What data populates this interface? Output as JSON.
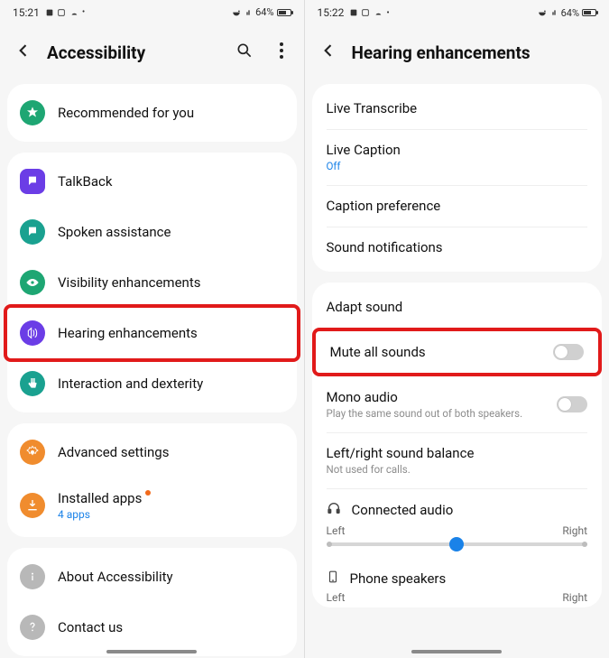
{
  "left": {
    "status": {
      "time": "15:21",
      "battery": "64%"
    },
    "title": "Accessibility",
    "group1": [
      {
        "label": "Recommended for you"
      }
    ],
    "group2": [
      {
        "label": "TalkBack"
      },
      {
        "label": "Spoken assistance"
      },
      {
        "label": "Visibility enhancements"
      },
      {
        "label": "Hearing enhancements"
      },
      {
        "label": "Interaction and dexterity"
      }
    ],
    "group3": [
      {
        "label": "Advanced settings"
      },
      {
        "label": "Installed apps",
        "sub": "4 apps"
      }
    ],
    "group4": [
      {
        "label": "About Accessibility"
      },
      {
        "label": "Contact us"
      }
    ]
  },
  "right": {
    "status": {
      "time": "15:22",
      "battery": "64%"
    },
    "title": "Hearing enhancements",
    "group1": [
      {
        "label": "Live Transcribe"
      },
      {
        "label": "Live Caption",
        "sub": "Off",
        "subBlue": true
      },
      {
        "label": "Caption preference"
      },
      {
        "label": "Sound notifications"
      }
    ],
    "group2": {
      "adapt": "Adapt sound",
      "mute": "Mute all sounds",
      "mono": {
        "label": "Mono audio",
        "sub": "Play the same sound out of both speakers."
      },
      "balance": {
        "label": "Left/right sound balance",
        "sub": "Not used for calls."
      },
      "connected": "Connected audio",
      "sliderLeft": "Left",
      "sliderRight": "Right",
      "phone": "Phone speakers",
      "slider2Left": "Left",
      "slider2Right": "Right"
    }
  }
}
